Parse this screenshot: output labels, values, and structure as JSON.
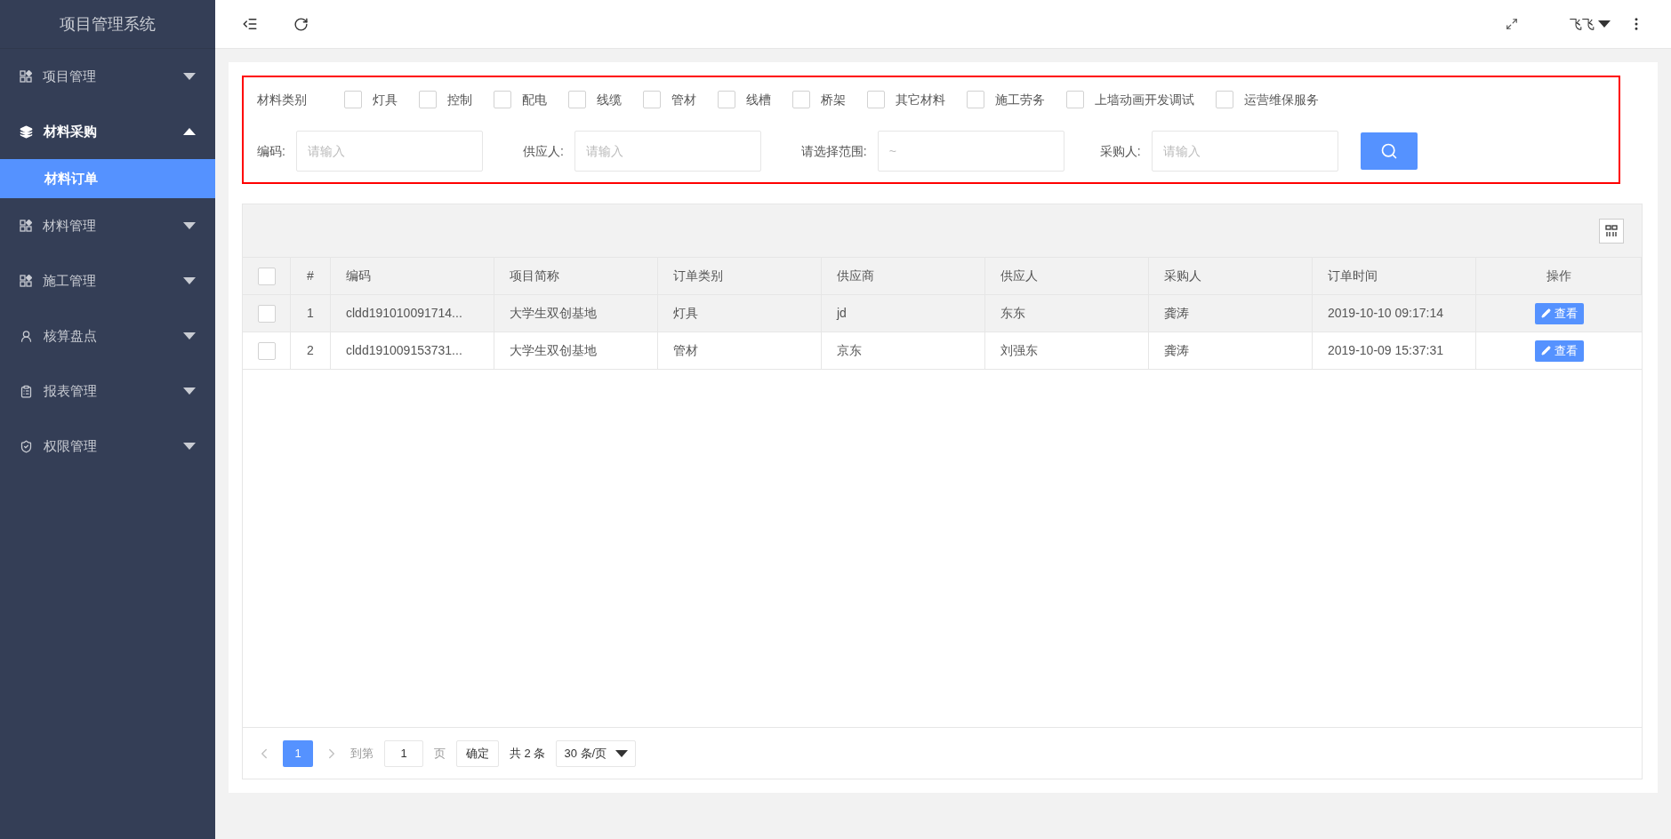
{
  "sidebar": {
    "title": "项目管理系统",
    "items": [
      {
        "label": "项目管理",
        "kind": "grid",
        "expanded": false
      },
      {
        "label": "材料采购",
        "kind": "layers",
        "expanded": true,
        "children": [
          {
            "label": "材料订单",
            "selected": true
          }
        ]
      },
      {
        "label": "材料管理",
        "kind": "grid",
        "expanded": false
      },
      {
        "label": "施工管理",
        "kind": "grid",
        "expanded": false
      },
      {
        "label": "核算盘点",
        "kind": "user",
        "expanded": false
      },
      {
        "label": "报表管理",
        "kind": "clipboard",
        "expanded": false
      },
      {
        "label": "权限管理",
        "kind": "shield",
        "expanded": false
      }
    ]
  },
  "topbar": {
    "user": "飞飞"
  },
  "filters": {
    "category_label": "材料类别",
    "categories": [
      {
        "label": "灯具",
        "checked": false
      },
      {
        "label": "控制",
        "checked": false
      },
      {
        "label": "配电",
        "checked": false
      },
      {
        "label": "线缆",
        "checked": false
      },
      {
        "label": "管材",
        "checked": false
      },
      {
        "label": "线槽",
        "checked": false
      },
      {
        "label": "桥架",
        "checked": false
      },
      {
        "label": "其它材料",
        "checked": false
      },
      {
        "label": "施工劳务",
        "checked": false
      },
      {
        "label": "上墙动画开发调试",
        "checked": false
      },
      {
        "label": "运营维保服务",
        "checked": false
      }
    ],
    "fields": [
      {
        "label": "编码:",
        "placeholder": "请输入"
      },
      {
        "label": "供应人:",
        "placeholder": "请输入"
      },
      {
        "label": "请选择范围:",
        "placeholder": "~"
      },
      {
        "label": "采购人:",
        "placeholder": "请输入"
      }
    ]
  },
  "table": {
    "select_all_checked": false,
    "columns": [
      "#",
      "编码",
      "项目简称",
      "订单类别",
      "供应商",
      "供应人",
      "采购人",
      "订单时间",
      "操作"
    ],
    "rows": [
      {
        "checked": false,
        "highlighted": true,
        "cells": [
          "1",
          "cldd191010091714...",
          "大学生双创基地",
          "灯具",
          "jd",
          "东东",
          "龚涛",
          "2019-10-10 09:17:14"
        ],
        "action": "查看"
      },
      {
        "checked": false,
        "highlighted": false,
        "cells": [
          "2",
          "cldd191009153731...",
          "大学生双创基地",
          "管材",
          "京东",
          "刘强东",
          "龚涛",
          "2019-10-09 15:37:31"
        ],
        "action": "查看"
      }
    ]
  },
  "pagination": {
    "pages": [
      {
        "label": "1",
        "selected": true
      }
    ],
    "goto_label": "到第",
    "goto_value": "1",
    "page_unit": "页",
    "confirm": "确定",
    "total": "共 2 条",
    "page_size": "30 条/页"
  }
}
